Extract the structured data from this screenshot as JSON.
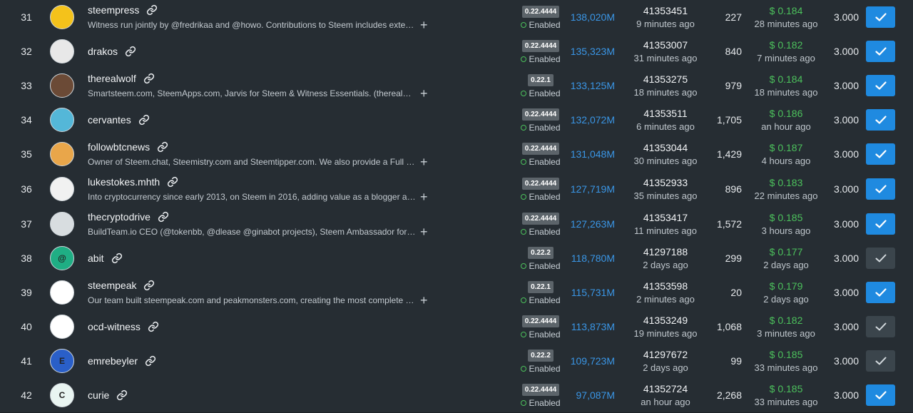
{
  "witnesses": [
    {
      "rank": "31",
      "name": "steempress",
      "description": "Witness run jointly by @fredrikaa and @howo. Contributions to Steem includes extensi…",
      "version": "0.22.4444",
      "status": "Enabled",
      "votes": "138,020M",
      "block": "41353451",
      "block_time": "9 minutes ago",
      "missed": "227",
      "price": "$ 0.184",
      "price_time": "28 minutes ago",
      "apr": "3.000",
      "voted": true,
      "avatar_color": "#f4c21b",
      "avatar_letter": ""
    },
    {
      "rank": "32",
      "name": "drakos",
      "description": "",
      "version": "0.22.4444",
      "status": "Enabled",
      "votes": "135,323M",
      "block": "41353007",
      "block_time": "31 minutes ago",
      "missed": "840",
      "price": "$ 0.182",
      "price_time": "7 minutes ago",
      "apr": "3.000",
      "voted": true,
      "avatar_color": "#e8e8e8",
      "avatar_letter": ""
    },
    {
      "rank": "33",
      "name": "therealwolf",
      "description": "Smartsteem.com, SteemApps.com, Jarvis for Steem & Witness Essentials. (therealwolf.m…",
      "version": "0.22.1",
      "status": "Enabled",
      "votes": "133,125M",
      "block": "41353275",
      "block_time": "18 minutes ago",
      "missed": "979",
      "price": "$ 0.184",
      "price_time": "18 minutes ago",
      "apr": "3.000",
      "voted": true,
      "avatar_color": "#6b4a36",
      "avatar_letter": ""
    },
    {
      "rank": "34",
      "name": "cervantes",
      "description": "",
      "version": "0.22.4444",
      "status": "Enabled",
      "votes": "132,072M",
      "block": "41353511",
      "block_time": "6 minutes ago",
      "missed": "1,705",
      "price": "$ 0.186",
      "price_time": "an hour ago",
      "apr": "3.000",
      "voted": true,
      "avatar_color": "#54b7d8",
      "avatar_letter": ""
    },
    {
      "rank": "35",
      "name": "followbtcnews",
      "description": "Owner of Steem.chat, Steemistry.com and Steemtipper.com. We also provide a Full Publ…",
      "version": "0.22.4444",
      "status": "Enabled",
      "votes": "131,048M",
      "block": "41353044",
      "block_time": "30 minutes ago",
      "missed": "1,429",
      "price": "$ 0.187",
      "price_time": "4 hours ago",
      "apr": "3.000",
      "voted": true,
      "avatar_color": "#e9a64a",
      "avatar_letter": ""
    },
    {
      "rank": "36",
      "name": "lukestokes.mhth",
      "description": "Into cryptocurrency since early 2013, on Steem in 2016, adding value as a blogger an…",
      "version": "0.22.4444",
      "status": "Enabled",
      "votes": "127,719M",
      "block": "41352933",
      "block_time": "35 minutes ago",
      "missed": "896",
      "price": "$ 0.183",
      "price_time": "22 minutes ago",
      "apr": "3.000",
      "voted": true,
      "avatar_color": "#f1f1f1",
      "avatar_letter": ""
    },
    {
      "rank": "37",
      "name": "thecryptodrive",
      "description": "BuildTeam.io CEO (@tokenbb, @dlease @ginabot projects), Steem Ambassador for listing…",
      "version": "0.22.4444",
      "status": "Enabled",
      "votes": "127,263M",
      "block": "41353417",
      "block_time": "11 minutes ago",
      "missed": "1,572",
      "price": "$ 0.185",
      "price_time": "3 hours ago",
      "apr": "3.000",
      "voted": true,
      "avatar_color": "#d8dde0",
      "avatar_letter": ""
    },
    {
      "rank": "38",
      "name": "abit",
      "description": "",
      "version": "0.22.2",
      "status": "Enabled",
      "votes": "118,780M",
      "block": "41297188",
      "block_time": "2 days ago",
      "missed": "299",
      "price": "$ 0.177",
      "price_time": "2 days ago",
      "apr": "3.000",
      "voted": false,
      "avatar_color": "#1fae84",
      "avatar_letter": "@"
    },
    {
      "rank": "39",
      "name": "steempeak",
      "description": "Our team built steempeak.com and peakmonsters.com, creating the most complete and in…",
      "version": "0.22.1",
      "status": "Enabled",
      "votes": "115,731M",
      "block": "41353598",
      "block_time": "2 minutes ago",
      "missed": "20",
      "price": "$ 0.179",
      "price_time": "2 days ago",
      "apr": "3.000",
      "voted": true,
      "avatar_color": "#ffffff",
      "avatar_letter": ""
    },
    {
      "rank": "40",
      "name": "ocd-witness",
      "description": "",
      "version": "0.22.4444",
      "status": "Enabled",
      "votes": "113,873M",
      "block": "41353249",
      "block_time": "19 minutes ago",
      "missed": "1,068",
      "price": "$ 0.182",
      "price_time": "3 minutes ago",
      "apr": "3.000",
      "voted": false,
      "avatar_color": "#ffffff",
      "avatar_letter": ""
    },
    {
      "rank": "41",
      "name": "emrebeyler",
      "description": "",
      "version": "0.22.2",
      "status": "Enabled",
      "votes": "109,723M",
      "block": "41297672",
      "block_time": "2 days ago",
      "missed": "99",
      "price": "$ 0.185",
      "price_time": "33 minutes ago",
      "apr": "3.000",
      "voted": false,
      "avatar_color": "#2a5fc8",
      "avatar_letter": "E"
    },
    {
      "rank": "42",
      "name": "curie",
      "description": "",
      "version": "0.22.4444",
      "status": "Enabled",
      "votes": "97,087M",
      "block": "41352724",
      "block_time": "an hour ago",
      "missed": "2,268",
      "price": "$ 0.185",
      "price_time": "33 minutes ago",
      "apr": "3.000",
      "voted": true,
      "avatar_color": "#e9f5f2",
      "avatar_letter": "C"
    }
  ],
  "colors": {
    "votes": "#3a96e6",
    "price": "#4cc15c",
    "vote_on": "#1f8ae0",
    "vote_off": "#3b454c"
  }
}
